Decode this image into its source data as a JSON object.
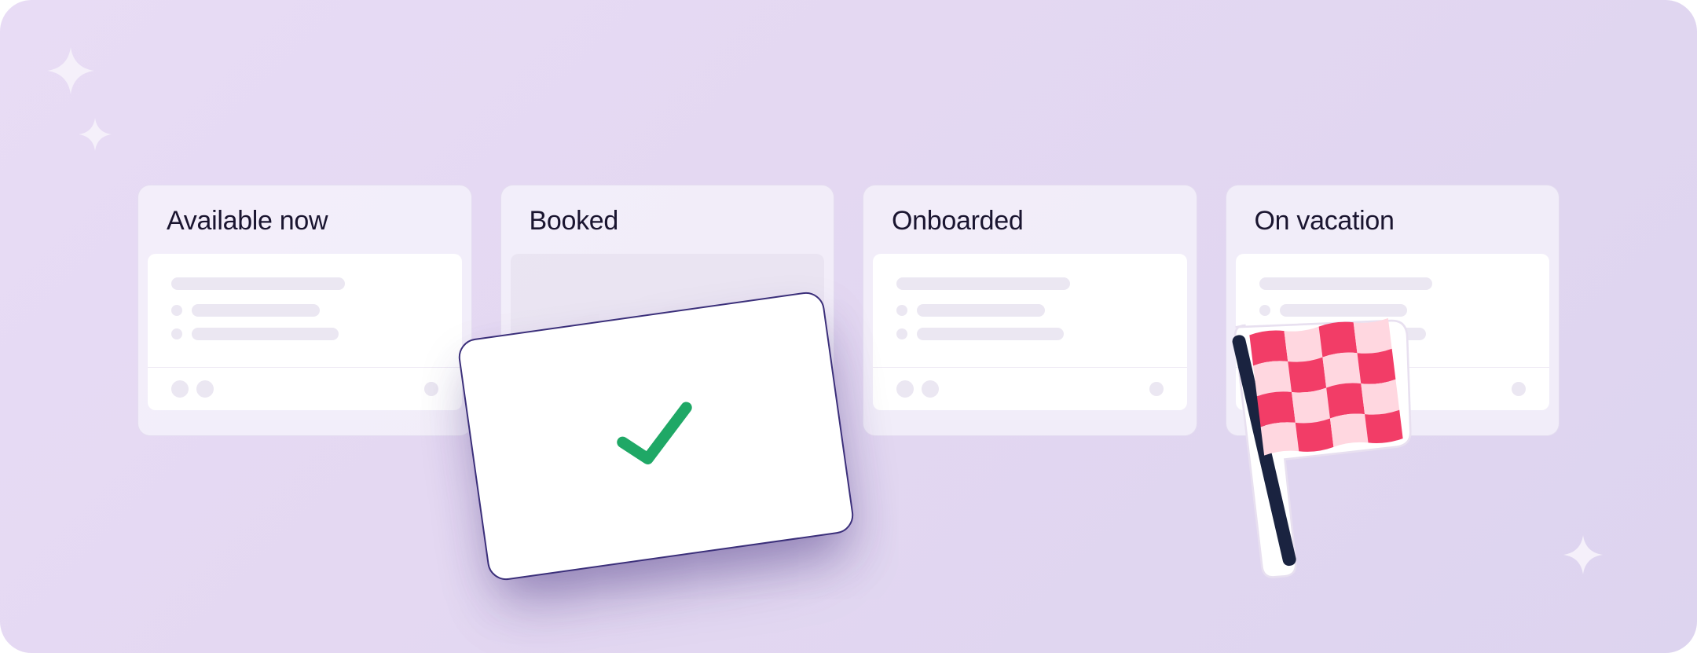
{
  "columns": [
    {
      "title": "Available now"
    },
    {
      "title": "Booked"
    },
    {
      "title": "Onboarded"
    },
    {
      "title": "On vacation"
    }
  ],
  "decorations": {
    "floating_card_icon": "checkmark-icon",
    "flag_sticker_icon": "checkered-flag-icon",
    "sparkle_icon": "sparkle-icon"
  },
  "colors": {
    "background_gradient_start": "#e8dcf5",
    "background_gradient_end": "#ddd4ef",
    "column_bg": "rgba(248,246,252,0.7)",
    "text_primary": "#1a1530",
    "skeleton": "#ebe7f2",
    "checkmark": "#1fa866",
    "flag_red": "#f23d67",
    "flag_pole": "#1a2340"
  }
}
